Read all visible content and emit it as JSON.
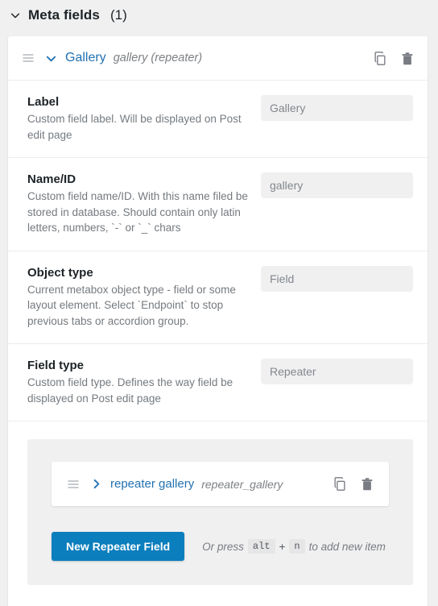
{
  "section": {
    "title": "Meta fields",
    "count": "(1)",
    "toggle_icon": "chevron-down-icon"
  },
  "field": {
    "header": {
      "drag_icon": "drag-handle-icon",
      "toggle_icon": "chevron-down-icon",
      "name": "Gallery",
      "slug": "gallery (repeater)",
      "duplicate_icon": "copy-icon",
      "delete_icon": "trash-icon"
    },
    "settings": [
      {
        "title": "Label",
        "description": "Custom field label. Will be displayed on Post edit page",
        "value": "Gallery"
      },
      {
        "title": "Name/ID",
        "description": "Custom field name/ID. With this name filed be stored in database. Should contain only latin letters, numbers, `-` or `_` chars",
        "value": "gallery"
      },
      {
        "title": "Object type",
        "description": "Current metabox object type - field or some layout element. Select `Endpoint` to stop previous tabs or accordion group.",
        "value": "Field"
      },
      {
        "title": "Field type",
        "description": "Custom field type. Defines the way field be displayed on Post edit page",
        "value": "Repeater"
      }
    ],
    "repeater": {
      "item": {
        "drag_icon": "drag-handle-icon",
        "toggle_icon": "chevron-right-icon",
        "name": "repeater gallery",
        "slug": "repeater_gallery",
        "duplicate_icon": "copy-icon",
        "delete_icon": "trash-icon"
      },
      "add_button_label": "New Repeater Field",
      "hint": {
        "prefix": "Or press",
        "key1": "alt",
        "plus": "+",
        "key2": "n",
        "suffix": "to add new item"
      }
    }
  },
  "colors": {
    "accent_link": "#2271b1",
    "button_blue": "#0b7ebd",
    "input_bg": "#f0f0f1",
    "page_bg": "#f0f0f1",
    "panel_bg": "#ffffff",
    "text_dark": "#1d2327",
    "text_muted": "#757a7f"
  }
}
